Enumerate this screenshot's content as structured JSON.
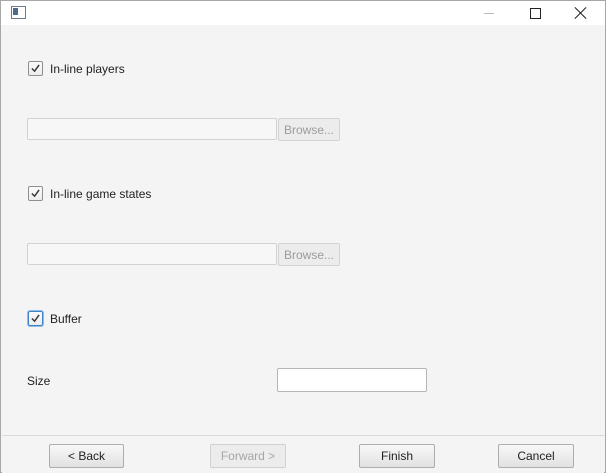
{
  "window": {
    "title": ""
  },
  "options": {
    "inline_players": {
      "label": "In-line players",
      "checked": true,
      "browse_label": "Browse...",
      "path_value": ""
    },
    "inline_game_states": {
      "label": "In-line game states",
      "checked": true,
      "browse_label": "Browse...",
      "path_value": ""
    },
    "buffer": {
      "label": "Buffer",
      "checked": true
    }
  },
  "size": {
    "label": "Size",
    "value": ""
  },
  "footer": {
    "back_label": "< Back",
    "forward_label": "Forward >",
    "finish_label": "Finish",
    "cancel_label": "Cancel"
  },
  "colors": {
    "accent": "#3d84c9",
    "background": "#f4f4f4"
  },
  "icons": [
    "app-icon",
    "minimize-icon",
    "maximize-icon",
    "close-icon",
    "checkmark-icon"
  ]
}
